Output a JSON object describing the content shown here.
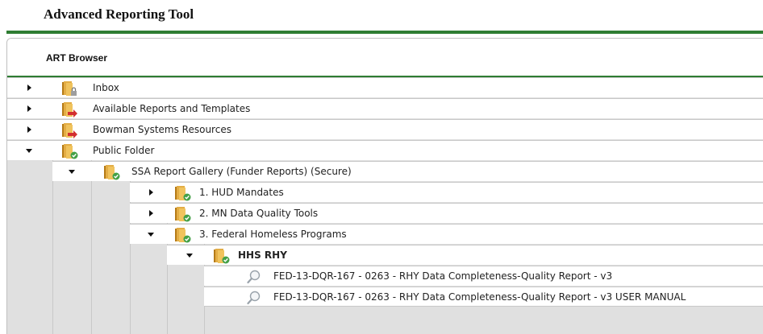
{
  "app_title": "Advanced Reporting Tool",
  "panel_title": "ART Browser",
  "colors": {
    "accent_green": "#2e7d32",
    "folder_gold": "#d9a43a",
    "badge_red": "#d32f2f",
    "badge_green": "#43a047"
  },
  "tree": [
    {
      "label": "Inbox",
      "state": "collapsed",
      "icon": "folder-lock-icon"
    },
    {
      "label": "Available Reports and Templates",
      "state": "collapsed",
      "icon": "folder-shared-icon"
    },
    {
      "label": "Bowman Systems Resources",
      "state": "collapsed",
      "icon": "folder-shared-icon"
    },
    {
      "label": "Public Folder",
      "state": "expanded",
      "icon": "folder-public-icon"
    },
    {
      "label": "SSA Report Gallery (Funder Reports) (Secure)",
      "state": "expanded",
      "icon": "folder-public-icon"
    },
    {
      "label": "1. HUD Mandates",
      "state": "collapsed",
      "icon": "folder-public-icon"
    },
    {
      "label": "2. MN Data Quality Tools",
      "state": "collapsed",
      "icon": "folder-public-icon"
    },
    {
      "label": "3. Federal Homeless Programs",
      "state": "expanded",
      "icon": "folder-public-icon"
    },
    {
      "label": "HHS RHY",
      "state": "expanded",
      "icon": "folder-public-icon"
    },
    {
      "label": "FED-13-DQR-167 - 0263 - RHY Data Completeness-Quality Report - v3",
      "state": "leaf",
      "icon": "report-magnifier-icon"
    },
    {
      "label": "FED-13-DQR-167 - 0263 - RHY Data Completeness-Quality Report - v3 USER MANUAL",
      "state": "leaf",
      "icon": "report-magnifier-icon"
    }
  ]
}
